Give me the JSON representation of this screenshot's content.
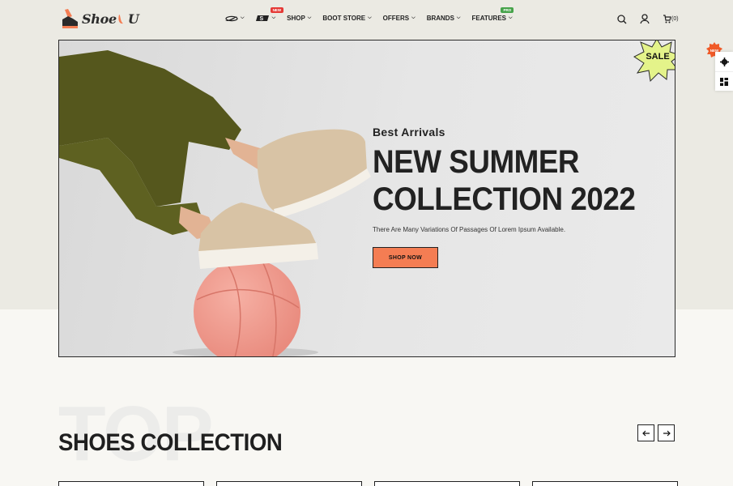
{
  "brand": {
    "logo_text_1": "Shoe",
    "logo_text_2": "U",
    "logo_letter": "U"
  },
  "nav": {
    "brand_icon_1": "nike-swoosh-icon",
    "brand_icon_2": "skechers-s-icon",
    "new_badge": "NEW",
    "pro_badge": "PRO",
    "items": [
      "SHOP",
      "BOOT STORE",
      "OFFERS",
      "BRANDS",
      "FEATURES"
    ]
  },
  "header_icons": {
    "search": "search-icon",
    "account": "user-icon",
    "cart": "cart-icon",
    "cart_count": "(0)"
  },
  "hero": {
    "sale_label": "SALE",
    "subtitle": "Best Arrivals",
    "title_line1": "NEW SUMMER",
    "title_line2": "COLLECTION 2022",
    "description": "There Are Many Variations Of Passages Of Lorem Ipsum Available.",
    "cta": "SHOP NOW"
  },
  "side_panel": {
    "new_badge": "NEW",
    "settings": "gear-icon",
    "layout": "grid-icon"
  },
  "section": {
    "bg_word": "TOP",
    "title": "SHOES COLLECTION"
  },
  "colors": {
    "accent": "#f47d53",
    "sale_star": "#e4f38a",
    "top_bg": "#ebeae3",
    "text": "#222222"
  }
}
